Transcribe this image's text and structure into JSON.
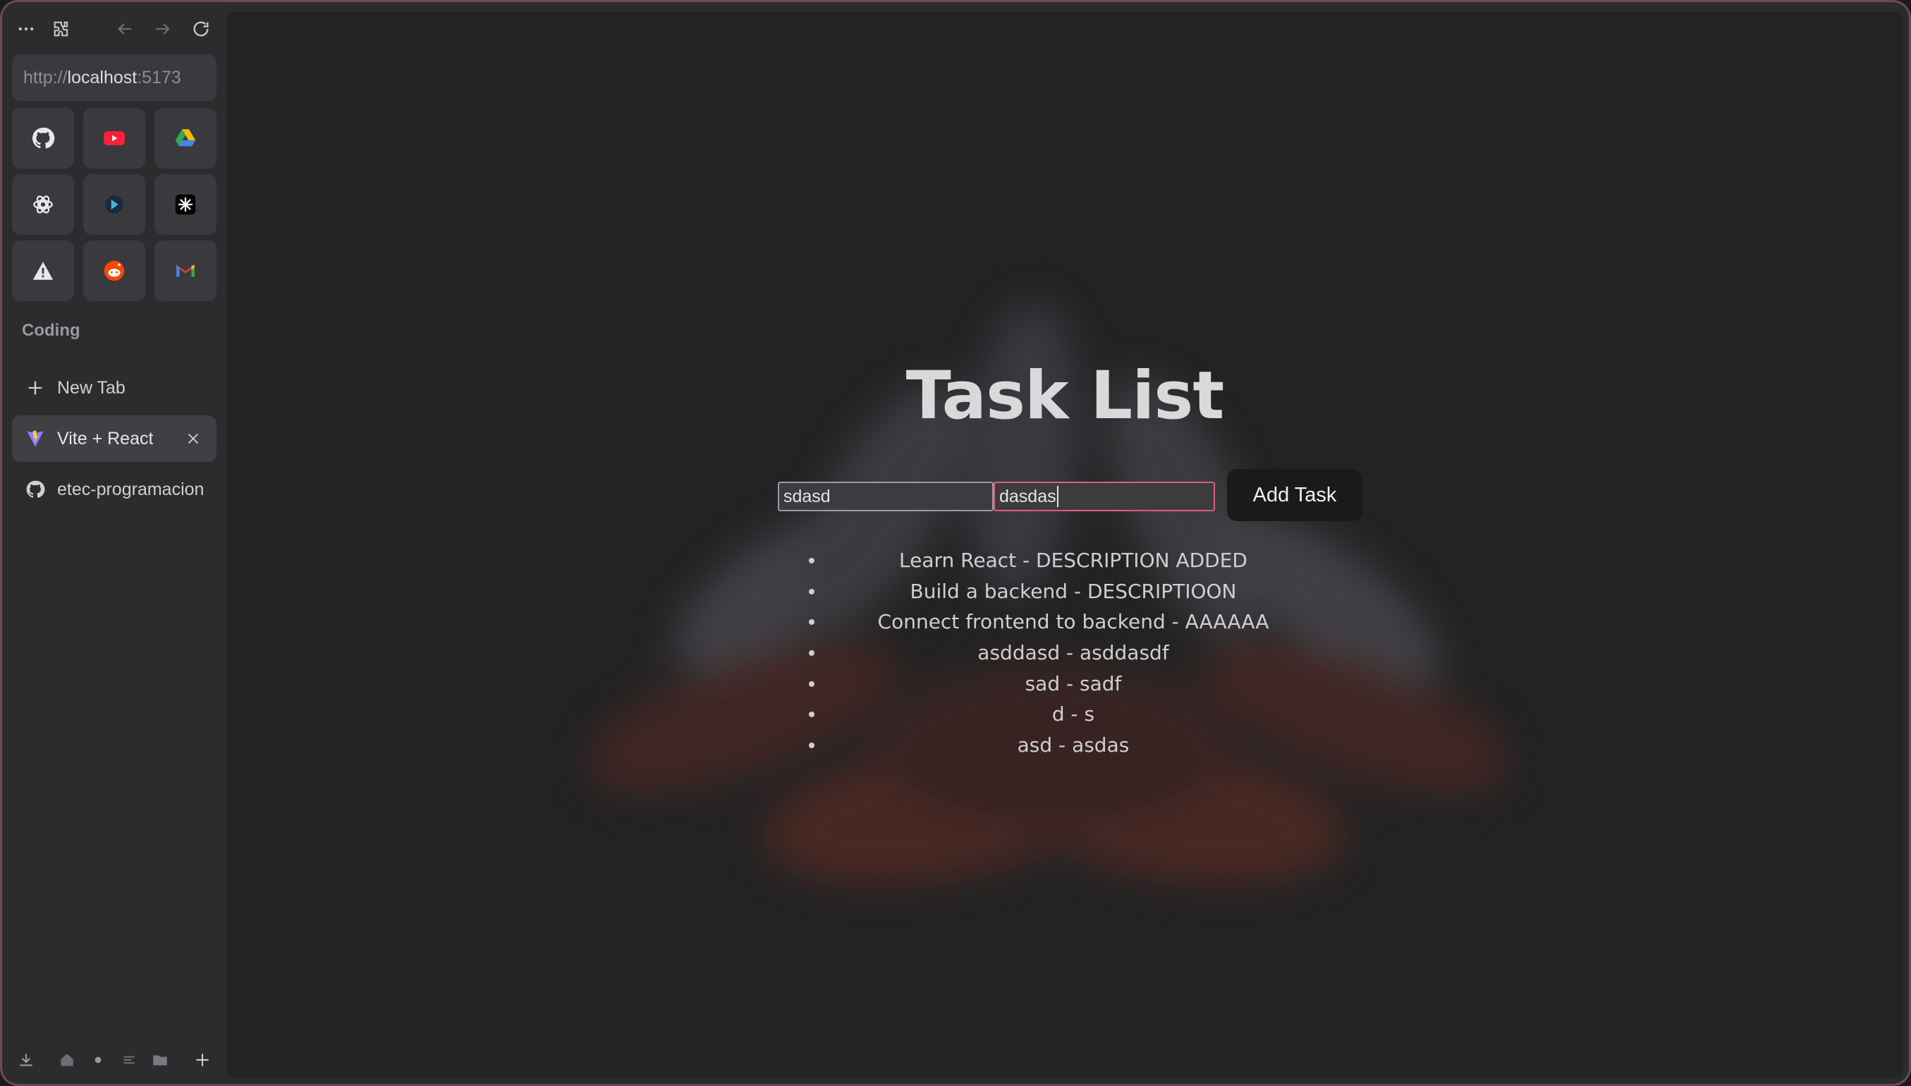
{
  "browser": {
    "url_scheme": "http://",
    "url_host": "localhost",
    "url_port": ":5173",
    "section_label": "Coding",
    "new_tab_label": "New Tab",
    "tabs": [
      {
        "label": "Vite + React",
        "icon": "vite-icon",
        "active": true
      },
      {
        "label": "etec-programacion",
        "icon": "github-icon",
        "active": false
      }
    ],
    "pinned": [
      "github-icon",
      "youtube-icon",
      "google-drive-icon",
      "chatgpt-icon",
      "perplexity-icon",
      "claude-icon",
      "warning-icon",
      "reddit-icon",
      "gmail-icon"
    ]
  },
  "app": {
    "title": "Task List",
    "inputs": {
      "title_value": "sdasd",
      "description_value": "dasdas"
    },
    "add_button_label": "Add Task",
    "tasks": [
      "Learn React - DESCRIPTION ADDED",
      "Build a backend - DESCRIPTIOON",
      "Connect frontend to backend - AAAAAA",
      "asddasd - asddasdf",
      "sad - sadf",
      "d - s",
      "asd - asdas"
    ]
  },
  "colors": {
    "accent_focus": "#d9627a",
    "window_border": "#6b4a58",
    "content_bg": "#232325"
  }
}
